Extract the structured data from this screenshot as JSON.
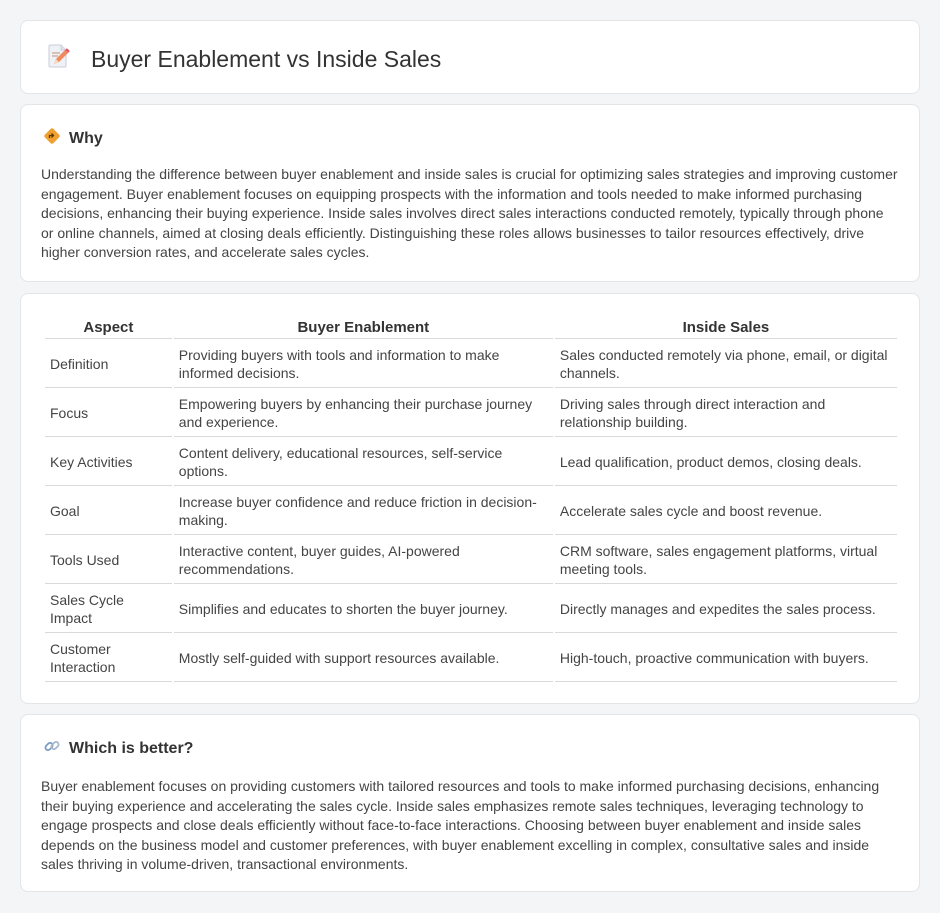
{
  "header": {
    "title": "Buyer Enablement vs Inside Sales",
    "icon": "document-pencil-icon"
  },
  "why": {
    "icon": "diamond-direction-icon",
    "title": "Why",
    "body": "Understanding the difference between buyer enablement and inside sales is crucial for optimizing sales strategies and improving customer engagement. Buyer enablement focuses on equipping prospects with the information and tools needed to make informed purchasing decisions, enhancing their buying experience. Inside sales involves direct sales interactions conducted remotely, typically through phone or online channels, aimed at closing deals efficiently. Distinguishing these roles allows businesses to tailor resources effectively, drive higher conversion rates, and accelerate sales cycles."
  },
  "table": {
    "headers": [
      "Aspect",
      "Buyer Enablement",
      "Inside Sales"
    ],
    "rows": [
      [
        "Definition",
        "Providing buyers with tools and information to make informed decisions.",
        "Sales conducted remotely via phone, email, or digital channels."
      ],
      [
        "Focus",
        "Empowering buyers by enhancing their purchase journey and experience.",
        "Driving sales through direct interaction and relationship building."
      ],
      [
        "Key Activities",
        "Content delivery, educational resources, self-service options.",
        "Lead qualification, product demos, closing deals."
      ],
      [
        "Goal",
        "Increase buyer confidence and reduce friction in decision-making.",
        "Accelerate sales cycle and boost revenue."
      ],
      [
        "Tools Used",
        "Interactive content, buyer guides, AI-powered recommendations.",
        "CRM software, sales engagement platforms, virtual meeting tools."
      ],
      [
        "Sales Cycle Impact",
        "Simplifies and educates to shorten the buyer journey.",
        "Directly manages and expedites the sales process."
      ],
      [
        "Customer Interaction",
        "Mostly self-guided with support resources available.",
        "High-touch, proactive communication with buyers."
      ]
    ]
  },
  "better": {
    "icon": "link-icon",
    "title": "Which is better?",
    "body": "Buyer enablement focuses on providing customers with tailored resources and tools to make informed purchasing decisions, enhancing their buying experience and accelerating the sales cycle. Inside sales emphasizes remote sales techniques, leveraging technology to engage prospects and close deals efficiently without face-to-face interactions. Choosing between buyer enablement and inside sales depends on the business model and customer preferences, with buyer enablement excelling in complex, consultative sales and inside sales thriving in volume-driven, transactional environments."
  },
  "colors": {
    "background": "#f4f5f7",
    "card": "#ffffff",
    "border": "#e3e5e8",
    "accent_orange": "#f0a030",
    "icon_blue": "#7b9cc4"
  }
}
